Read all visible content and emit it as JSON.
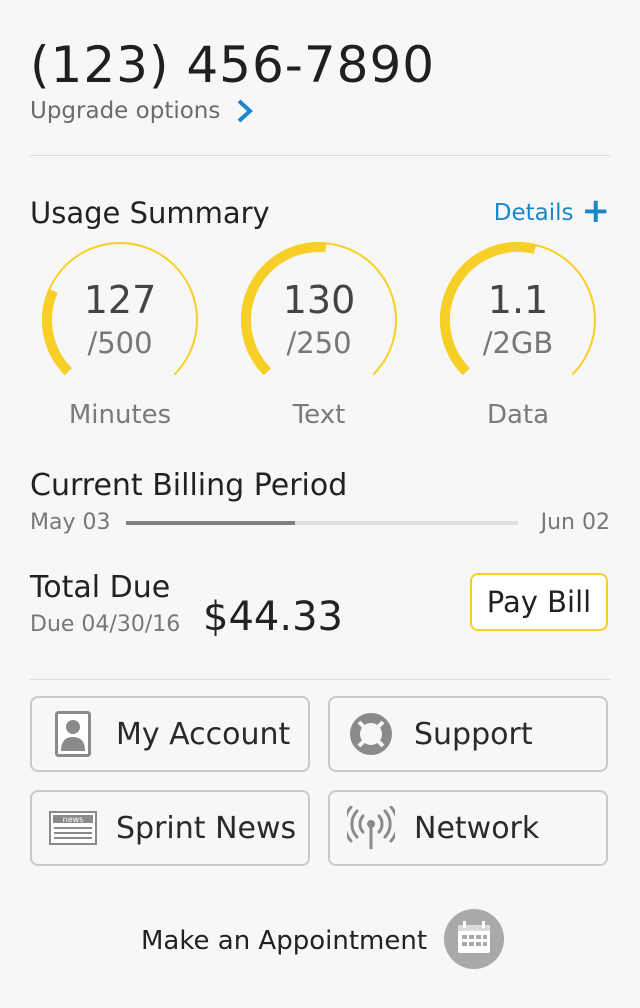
{
  "header": {
    "phone_number": "(123) 456-7890",
    "upgrade_label": "Upgrade options"
  },
  "usage": {
    "title": "Usage Summary",
    "details_label": "Details",
    "gauges": [
      {
        "used": "127",
        "total": "/500",
        "label": "Minutes",
        "fraction": 0.254
      },
      {
        "used": "130",
        "total": "/250",
        "label": "Text",
        "fraction": 0.52
      },
      {
        "used": "1.1",
        "total": "/2GB",
        "label": "Data",
        "fraction": 0.55
      }
    ]
  },
  "billing": {
    "title": "Current Billing Period",
    "start": "May 03",
    "end": "Jun 02",
    "progress": 0.43
  },
  "total": {
    "title": "Total Due",
    "due_date": "Due 04/30/16",
    "amount": "$44.33",
    "pay_label": "Pay Bill"
  },
  "tiles": [
    {
      "label": "My Account",
      "icon": "account-icon"
    },
    {
      "label": "Support",
      "icon": "lifebuoy-icon"
    },
    {
      "label": "Sprint News",
      "icon": "news-icon",
      "icon_text": "news"
    },
    {
      "label": "Network",
      "icon": "network-icon"
    }
  ],
  "appointment": {
    "label": "Make an Appointment",
    "icon": "calendar-icon"
  },
  "colors": {
    "accent_yellow": "#f7cf27",
    "link_blue": "#1a87c9",
    "text_dark": "#222222",
    "text_muted": "#777777"
  }
}
